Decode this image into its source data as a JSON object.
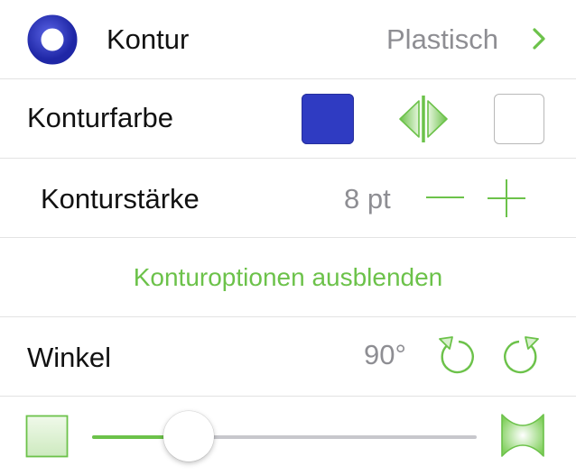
{
  "stroke_row": {
    "label": "Kontur",
    "value": "Plastisch"
  },
  "color_row": {
    "label": "Konturfarbe",
    "selected_color": "#2f3bc2",
    "secondary_color": "#ffffff"
  },
  "width_row": {
    "label": "Konturstärke",
    "value": "8 pt"
  },
  "options_link": {
    "label": "Konturoptionen ausblenden"
  },
  "angle_row": {
    "label": "Winkel",
    "value": "90°"
  },
  "cap_slider": {
    "level": 0.25
  },
  "accent_color": "#6cc24a"
}
